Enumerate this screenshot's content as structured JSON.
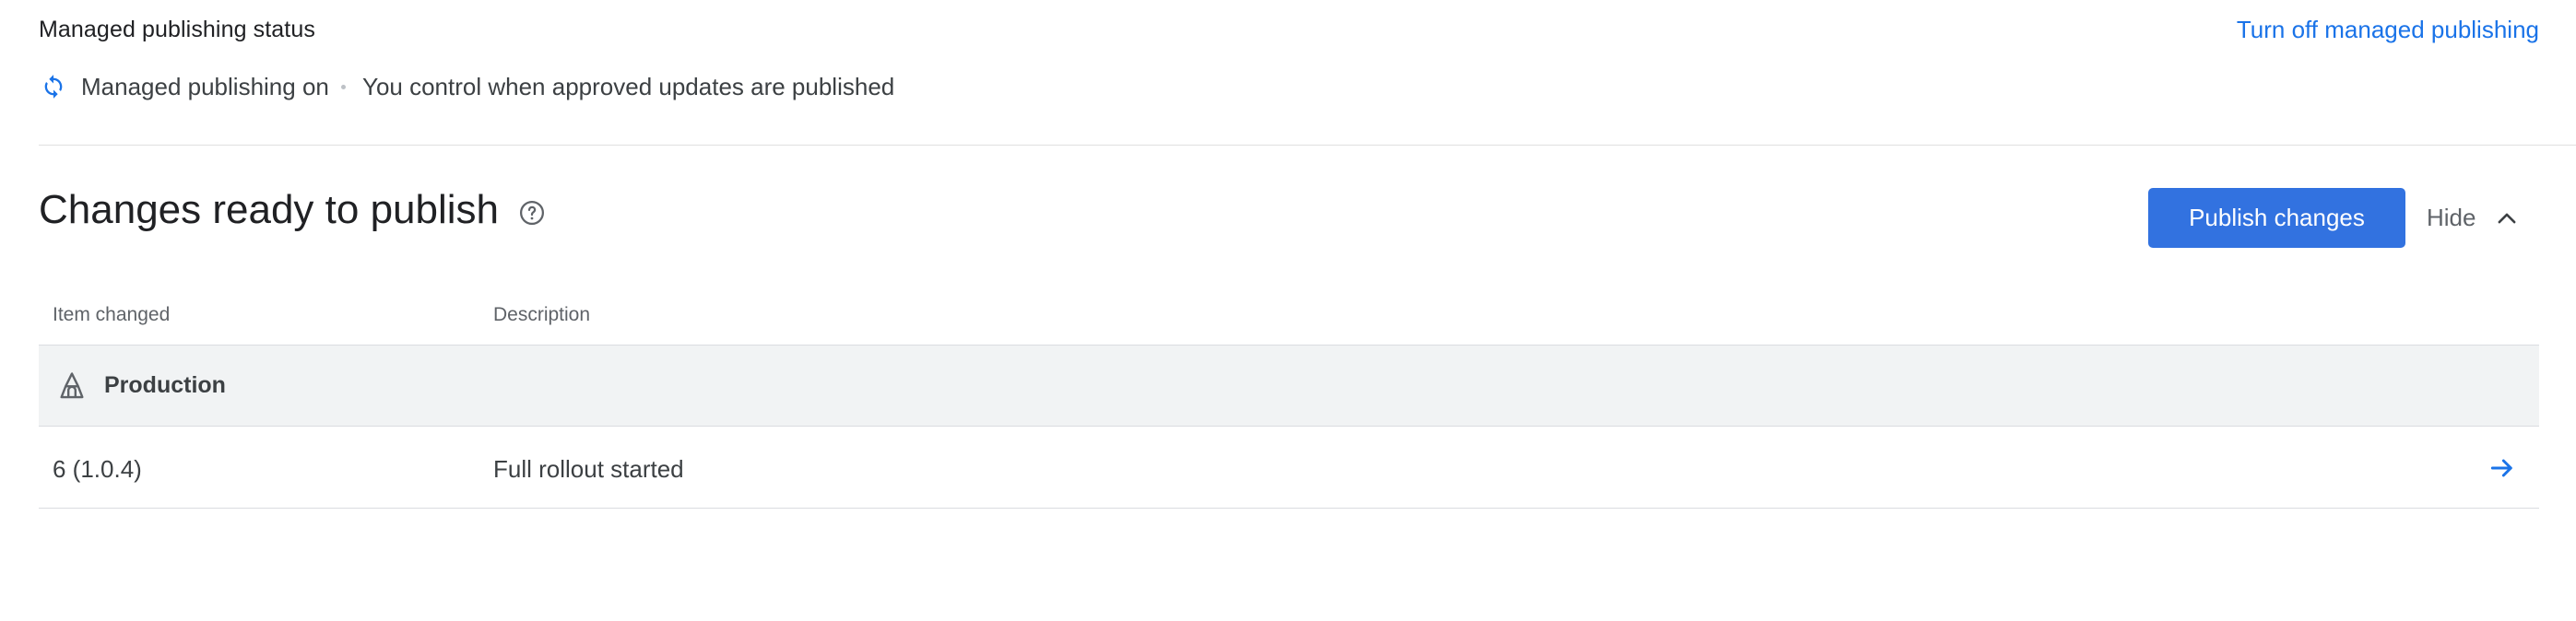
{
  "status": {
    "title": "Managed publishing status",
    "turn_off_link": "Turn off managed publishing",
    "state_label": "Managed publishing on",
    "description": "You control when approved updates are published",
    "icon": "sync-icon"
  },
  "changes": {
    "title": "Changes ready to publish",
    "help_icon": "help-circle-icon",
    "publish_button": "Publish changes",
    "hide_label": "Hide",
    "hide_icon": "chevron-up-icon"
  },
  "table": {
    "columns": [
      "Item changed",
      "Description"
    ],
    "groups": [
      {
        "label": "Production",
        "icon": "production-track-icon",
        "rows": [
          {
            "item": "6 (1.0.4)",
            "description": "Full rollout started",
            "action_icon": "arrow-right-icon"
          }
        ]
      }
    ]
  },
  "colors": {
    "accent": "#1a73e8",
    "button": "#3272e0",
    "group_bg": "#f1f3f4",
    "divider": "#dadce0"
  }
}
